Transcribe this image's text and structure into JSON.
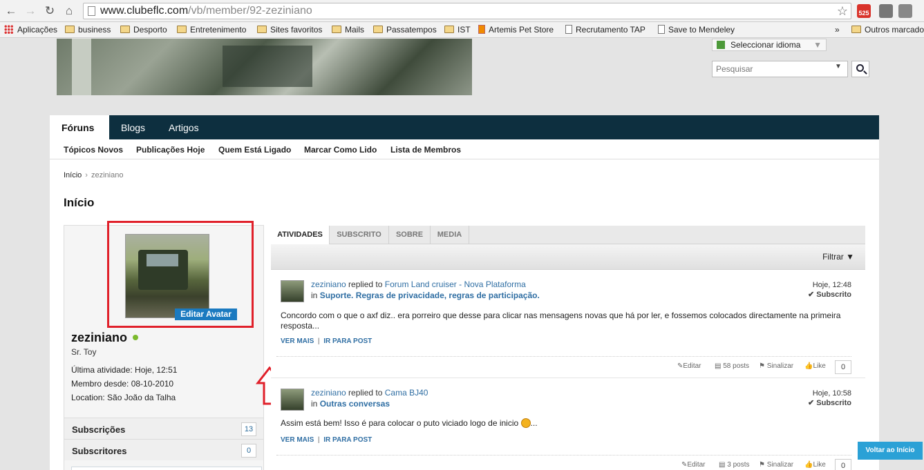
{
  "browser": {
    "url_host": "www.clubeflc.com",
    "url_path": "/vb/member/92-zeziniano",
    "bookmarks": [
      "Aplicações",
      "business",
      "Desporto",
      "Entretenimento",
      "Sites favoritos",
      "Mails",
      "Passatempos",
      "IST",
      "Artemis Pet Store",
      "Recrutamento TAP",
      "Save to Mendeley",
      "»",
      "Outros marcado"
    ],
    "gmail_badge": "525"
  },
  "header": {
    "language": "Seleccionar idioma",
    "search_placeholder": "Pesquisar"
  },
  "nav": {
    "tabs": [
      "Fóruns",
      "Blogs",
      "Artigos"
    ],
    "sublinks": [
      "Tópicos Novos",
      "Publicações Hoje",
      "Quem Está Ligado",
      "Marcar Como Lido",
      "Lista de Membros"
    ]
  },
  "breadcrumb": {
    "home": "Início",
    "sep": "›",
    "current": "zeziniano"
  },
  "page_title": "Início",
  "profile": {
    "edit_avatar": "Editar Avatar",
    "username": "zeziniano",
    "title": "Sr. Toy",
    "last_activity": "Última atividade: Hoje, 12:51",
    "member_since": "Membro desde: 08-10-2010",
    "location": "Location: São João da Talha",
    "subscriptions_label": "Subscrições",
    "subscriptions_count": "13",
    "subscribers_label": "Subscritores",
    "subscribers_count": "0"
  },
  "tabs": [
    "ATIVIDADES",
    "SUBSCRITO",
    "SOBRE",
    "MEDIA"
  ],
  "filter_label": "Filtrar",
  "posts": [
    {
      "user": "zeziniano",
      "action": "replied to",
      "thread": "Forum Land cruiser - Nova Plataforma",
      "in": "in",
      "forum": "Suporte. Regras de privacidade, regras de participação.",
      "time": "Hoje, 12:48",
      "subscribed": "Subscrito",
      "body": "Concordo com o que o axf diz.. era porreiro que desse para clicar nas mensagens novas que há por ler, e fossemos colocados directamente na primeira resposta...",
      "more": "VER MAIS",
      "pipe": "|",
      "goto": "IR PARA POST",
      "edit": "Editar",
      "posts": "58 posts",
      "report": "Sinalizar",
      "like": "Like",
      "likes": "0"
    },
    {
      "user": "zeziniano",
      "action": "replied to",
      "thread": "Cama BJ40",
      "in": "in",
      "forum": "Outras conversas",
      "time": "Hoje, 10:58",
      "subscribed": "Subscrito",
      "body_before": "Assim está bem! Isso é para colocar o puto viciado logo de inicio",
      "body_after": "...",
      "more": "VER MAIS",
      "pipe": "|",
      "goto": "IR PARA POST",
      "edit": "Editar",
      "posts": "3 posts",
      "report": "Sinalizar",
      "like": "Like",
      "likes": "0"
    }
  ],
  "back_to_top": "Voltar ao Início",
  "colors": {
    "navbar": "#0d2f3f",
    "link": "#2f6ea3",
    "highlight": "#e0202a",
    "back_top": "#2ba1d6"
  }
}
